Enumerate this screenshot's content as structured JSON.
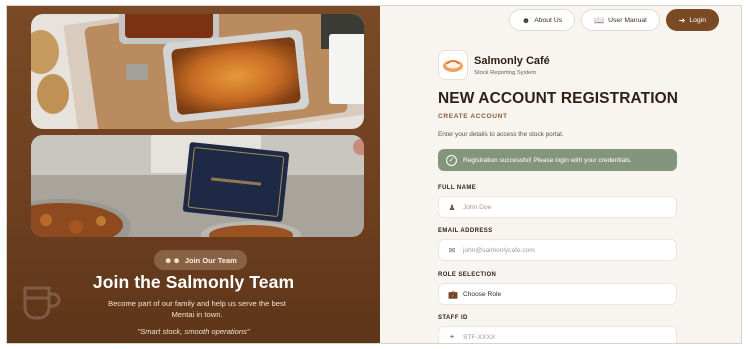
{
  "left": {
    "badge": {
      "icon": "group-icon",
      "label": "Join Our Team"
    },
    "title": "Join the Salmonly Team",
    "subtitle": "Become part of our family and help us serve the best Mentai in town.",
    "quote": "\"Smart stock, smooth operations\""
  },
  "nav": {
    "about": {
      "icon": "group-icon",
      "label": "About Us"
    },
    "manual": {
      "icon": "book-icon",
      "label": "User Manual"
    },
    "login": {
      "icon": "login-icon",
      "label": "Login"
    }
  },
  "brand": {
    "name": "Salmonly Café",
    "subtitle": "Stock Reporting System"
  },
  "form": {
    "title": "NEW ACCOUNT REGISTRATION",
    "section": "CREATE ACCOUNT",
    "instructions": "Enter your details to access the stock portal.",
    "alert": "Registration successful! Please login with your credentials.",
    "fields": [
      {
        "label": "FULL NAME",
        "icon": "user-icon",
        "placeholder": "John Doe",
        "value": ""
      },
      {
        "label": "EMAIL ADDRESS",
        "icon": "mail-icon",
        "placeholder": "john@salmonlycafe.com",
        "value": ""
      },
      {
        "label": "ROLE SELECTION",
        "icon": "briefcase-icon",
        "placeholder": "",
        "value": "Choose Role"
      },
      {
        "label": "STAFF ID",
        "icon": "id-icon",
        "placeholder": "STF-XXXX",
        "value": ""
      }
    ]
  },
  "colors": {
    "brand_brown": "#7a4a25",
    "success_green": "#83967c",
    "panel_bg": "#f8f5f1"
  }
}
